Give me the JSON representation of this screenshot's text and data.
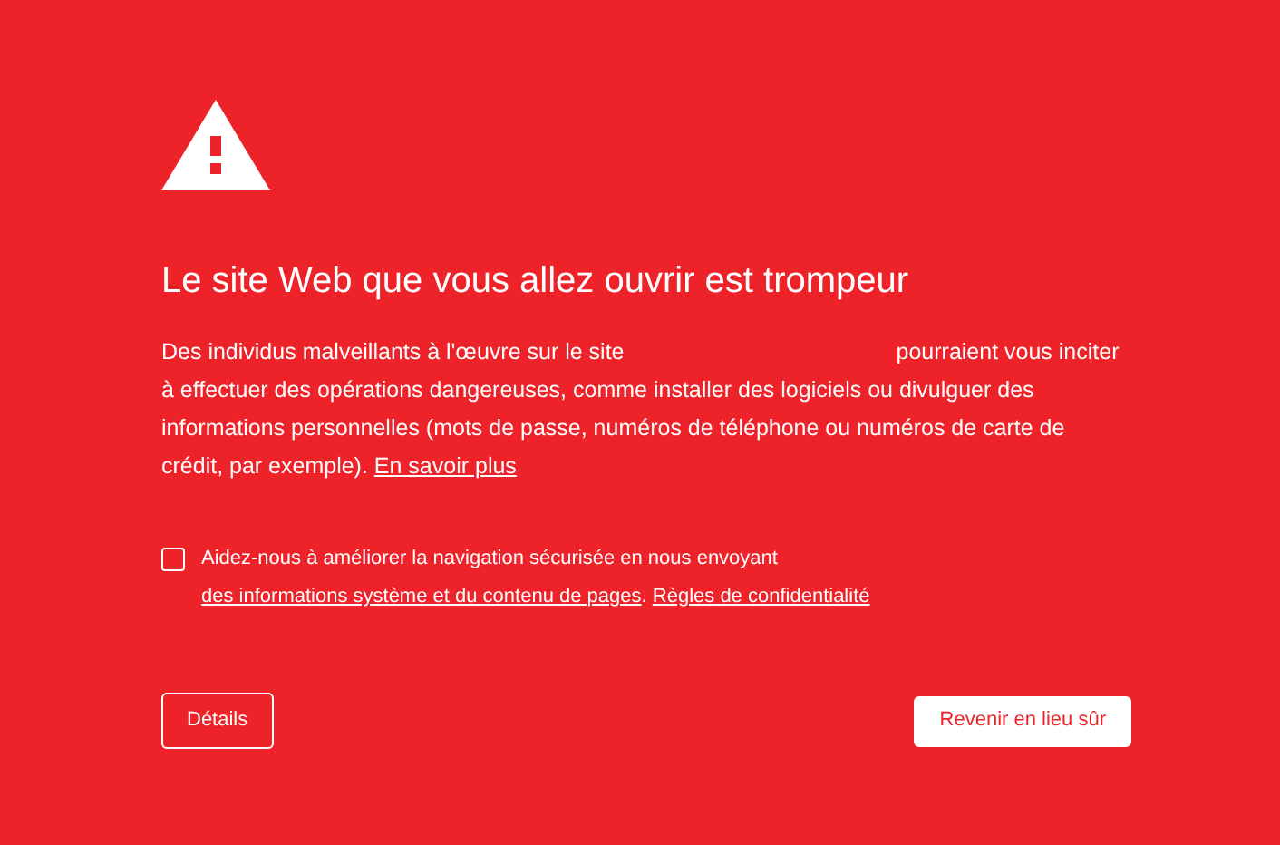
{
  "title": "Le site Web que vous allez ouvrir est trompeur",
  "description": {
    "before": "Des individus malveillants à l'œuvre sur le site",
    "after": "pourraient vous inciter à effectuer des opérations dangereuses, comme installer des logiciels ou divulguer des informations personnelles (mots de passe, numéros de téléphone ou numéros de carte de crédit, par exemple).",
    "link": "En savoir plus"
  },
  "report": {
    "checked": false,
    "text": "Aidez-nous à améliorer la navigation sécurisée en nous envoyant",
    "link": "des informations système et du contenu de pages",
    "separator": ".",
    "privacy_link": "Règles de confidentialité"
  },
  "buttons": [
    {
      "label": "Détails",
      "kind": "secondary"
    },
    {
      "label": "Revenir en lieu sûr",
      "kind": "primary"
    }
  ]
}
